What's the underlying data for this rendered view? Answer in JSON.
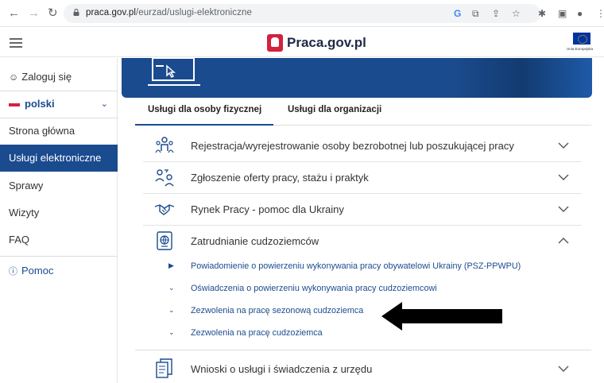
{
  "browser": {
    "url_domain": "praca.gov.pl",
    "url_path": "/eurzad/uslugi-elektroniczne"
  },
  "header": {
    "site_title": "Praca.gov.pl",
    "eu_label": "Unia Europejska"
  },
  "sidebar": {
    "login": "Zaloguj się",
    "language": "polski",
    "items": [
      {
        "label": "Strona główna",
        "active": false
      },
      {
        "label": "Usługi elektroniczne",
        "active": true
      },
      {
        "label": "Sprawy",
        "active": false
      },
      {
        "label": "Wizyty",
        "active": false
      },
      {
        "label": "FAQ",
        "active": false
      }
    ],
    "help": "Pomoc"
  },
  "tabs": [
    {
      "label": "Usługi dla osoby fizycznej",
      "active": true
    },
    {
      "label": "Usługi dla organizacji",
      "active": false
    }
  ],
  "services": [
    {
      "label": "Rejestracja/wyrejestrowanie osoby bezrobotnej lub poszukującej pracy",
      "icon": "people-registration-icon",
      "expanded": false
    },
    {
      "label": "Zgłoszenie oferty pracy, stażu i praktyk",
      "icon": "job-offer-icon",
      "expanded": false
    },
    {
      "label": "Rynek Pracy - pomoc dla Ukrainy",
      "icon": "handshake-icon",
      "expanded": false
    },
    {
      "label": "Zatrudnianie cudzoziemców",
      "icon": "passport-globe-icon",
      "expanded": true
    },
    {
      "label": "Wnioski o usługi i świadczenia z urzędu",
      "icon": "documents-icon",
      "expanded": false
    }
  ],
  "foreigners_subitems": [
    {
      "label": "Powiadomienie o powierzeniu wykonywania pracy obywatelowi Ukrainy (PSZ-PPWPU)",
      "marker": "right"
    },
    {
      "label": "Oświadczenia o powierzeniu wykonywania pracy cudzoziemcowi",
      "marker": "down"
    },
    {
      "label": "Zezwolenia na pracę sezonową cudzoziemca",
      "marker": "down"
    },
    {
      "label": "Zezwolenia na pracę cudzoziemca",
      "marker": "down"
    }
  ],
  "colors": {
    "accent": "#1b4b8f",
    "flag_red": "#d4213d"
  }
}
